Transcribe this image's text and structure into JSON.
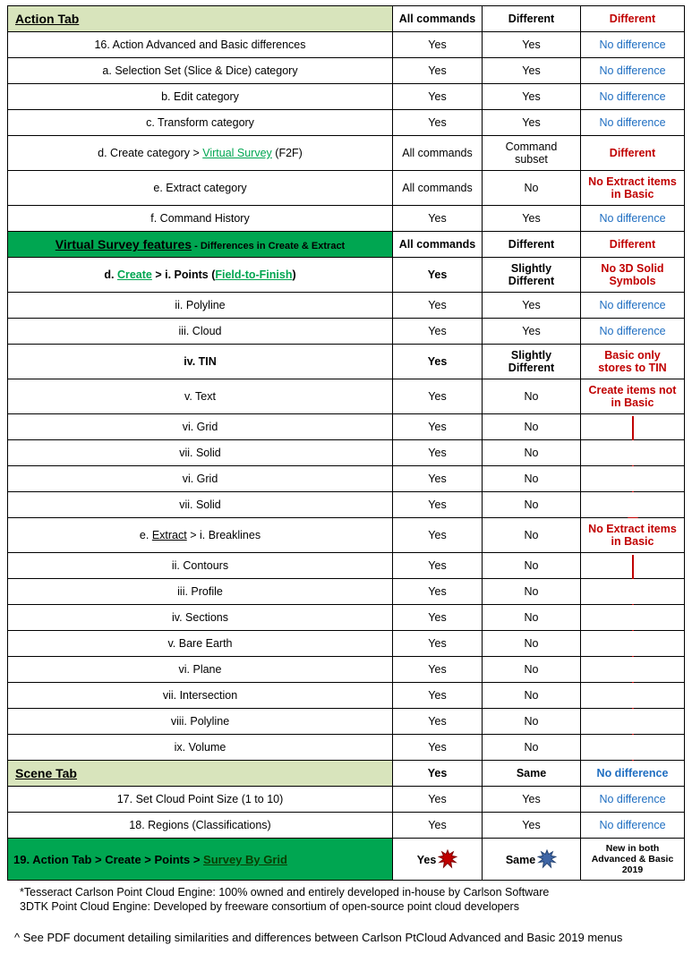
{
  "headers": {
    "action_tab": "Action Tab",
    "all_commands": "All commands",
    "different": "Different",
    "diff_red": "Different",
    "virtual_survey_title": "Virtual Survey features",
    "virtual_survey_sub": " -  Differences in Create & Extract",
    "scene_tab": "Scene Tab",
    "scene_yes": "Yes",
    "scene_same": "Same",
    "scene_diff": "No difference",
    "last_row_prefix": "19. Action Tab > Create > Points > ",
    "last_row_link": "Survey By Grid",
    "last_yes": "Yes",
    "last_same": "Same",
    "last_new": "New in both Advanced & Basic 2019"
  },
  "action_rows": [
    {
      "label": "16. Action Advanced and Basic differences",
      "a": "Yes",
      "b": "Yes",
      "b_blue": true,
      "diff": "No difference",
      "diff_style": "blue"
    },
    {
      "label": "a. Selection Set (Slice & Dice) category",
      "a": "Yes",
      "b": "Yes",
      "b_blue": true,
      "diff": "No difference",
      "diff_style": "blue"
    },
    {
      "label": "b. Edit category",
      "a": "Yes",
      "b": "Yes",
      "b_blue": true,
      "diff": "No difference",
      "diff_style": "blue"
    },
    {
      "label": "c. Transform category",
      "a": "Yes",
      "b": "Yes",
      "b_blue": true,
      "diff": "No difference",
      "diff_style": "blue"
    },
    {
      "label_html": true,
      "pre": "d. Create category > ",
      "link": "Virtual Survey",
      "post": " (F2F)",
      "a": "All commands",
      "b": "Command subset",
      "b_blue": true,
      "diff": "Different",
      "diff_style": "red"
    },
    {
      "label": "e. Extract category",
      "a": "All commands",
      "b": "No",
      "b_blue": false,
      "diff": "No Extract items in Basic",
      "diff_style": "red"
    },
    {
      "label": "f. Command History",
      "a": "Yes",
      "b": "Yes",
      "b_blue": true,
      "diff": "No difference",
      "diff_style": "blue"
    }
  ],
  "vs_rows": [
    {
      "label_html": true,
      "pre": "d. ",
      "link": "Create",
      "mid": " > i. Points (",
      "link2": "Field-to-Finish",
      "post": ")",
      "bold": true,
      "a": "Yes",
      "a_bold": true,
      "b": "Slightly Different",
      "b_blue": true,
      "b_bold": true,
      "diff": "No 3D Solid Symbols",
      "diff_style": "red"
    },
    {
      "label": "ii. Polyline",
      "a": "Yes",
      "b": "Yes",
      "b_blue": true,
      "diff": "No difference",
      "diff_style": "blue"
    },
    {
      "label": "iii. Cloud",
      "a": "Yes",
      "b": "Yes",
      "b_blue": true,
      "diff": "No difference",
      "diff_style": "blue"
    },
    {
      "label": "iv. TIN",
      "bold": true,
      "a": "Yes",
      "a_bold": true,
      "b": "Slightly Different",
      "b_blue": true,
      "b_bold": true,
      "diff_html": true,
      "diff_pre": "Basic only stores to ",
      "diff_span": "TIN",
      "diff_style": "red"
    },
    {
      "label": "v. Text",
      "a": "Yes",
      "b": "No",
      "diff": "Create items not in Basic",
      "diff_style": "red"
    },
    {
      "label": "vi. Grid",
      "a": "Yes",
      "b": "No",
      "diff": "",
      "arrow_start": "tall"
    },
    {
      "label": "vii. Solid",
      "a": "Yes",
      "b": "No",
      "diff": ""
    },
    {
      "label": "vi. Grid",
      "a": "Yes",
      "b": "No",
      "diff": ""
    },
    {
      "label": "vii. Solid",
      "a": "Yes",
      "b": "No",
      "diff": ""
    },
    {
      "label_html": true,
      "pre": "e. ",
      "u": "Extract",
      "post": " > i. Breaklines",
      "a": "Yes",
      "b": "No",
      "diff": "No Extract items in Basic",
      "diff_style": "red"
    },
    {
      "label": "ii. Contours",
      "a": "Yes",
      "b": "No",
      "diff": "",
      "arrow_start": "tall2"
    },
    {
      "label": "iii. Profile",
      "a": "Yes",
      "b": "No",
      "diff": ""
    },
    {
      "label": "iv. Sections",
      "a": "Yes",
      "b": "No",
      "diff": ""
    },
    {
      "label": "v. Bare Earth",
      "a": "Yes",
      "b": "No",
      "diff": ""
    },
    {
      "label": "vi. Plane",
      "a": "Yes",
      "b": "No",
      "diff": ""
    },
    {
      "label": "vii. Intersection",
      "a": "Yes",
      "b": "No",
      "diff": ""
    },
    {
      "label": "viii. Polyline",
      "a": "Yes",
      "b": "No",
      "diff": ""
    },
    {
      "label": "ix. Volume",
      "a": "Yes",
      "b": "No",
      "diff": ""
    }
  ],
  "scene_rows": [
    {
      "label": "17. Set Cloud Point Size (1 to 10)",
      "a": "Yes",
      "b": "Yes",
      "diff": "No difference",
      "diff_style": "blue"
    },
    {
      "label": "18. Regions (Classifications)",
      "a": "Yes",
      "b": "Yes",
      "diff": "No difference",
      "diff_style": "blue"
    }
  ],
  "notes": {
    "n1": "*Tesseract Carlson Point Cloud Engine: 100% owned and entirely developed in-house by Carlson Software",
    "n2": " 3DTK Point Cloud Engine: Developed by freeware consortium of open-source point cloud developers",
    "pdf": "^ See PDF document detailing similarities and differences between Carlson PtCloud Advanced and Basic 2019 menus"
  }
}
